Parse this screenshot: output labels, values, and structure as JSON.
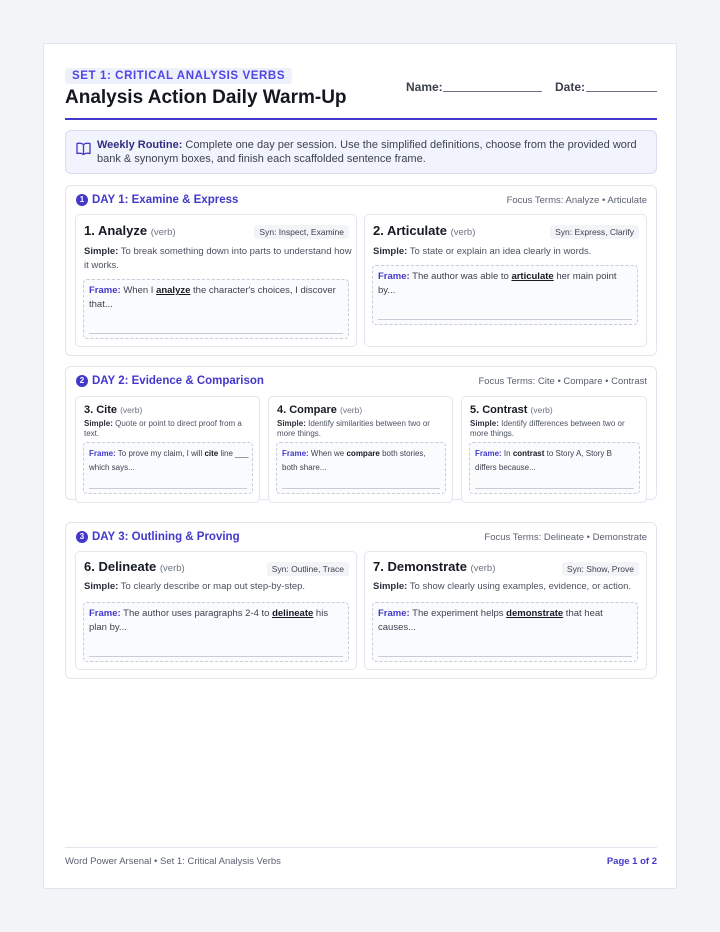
{
  "header": {
    "set_label": "SET 1: CRITICAL ANALYSIS VERBS",
    "title": "Analysis Action Daily Warm-Up",
    "name_label": "Name:",
    "date_label": "Date:"
  },
  "routine": {
    "icon": "book-icon",
    "label": "Weekly Routine:",
    "text": " Complete one day per session. Use the simplified definitions, choose from the provided word bank & synonym boxes, and finish each scaffolded sentence frame."
  },
  "days": [
    {
      "number": "1",
      "title": "DAY 1: Examine & Express",
      "focus": "Focus Terms: Analyze • Articulate",
      "words": [
        {
          "name": "1. Analyze",
          "pos": "(verb)",
          "syn": "Syn: Inspect, Examine",
          "simple_label": "Simple:",
          "simple": " To break something down into parts to understand how it works.",
          "frame_label": "Frame:",
          "frame_pre": " When I ",
          "frame_kw": "analyze",
          "frame_post": " the character's choices, I discover that..."
        },
        {
          "name": "2. Articulate",
          "pos": "(verb)",
          "syn": "Syn: Express, Clarify",
          "simple_label": "Simple:",
          "simple": " To state or explain an idea clearly in words.",
          "frame_label": "Frame:",
          "frame_pre": " The author was able to ",
          "frame_kw": "articulate",
          "frame_post": " her main point by..."
        }
      ]
    },
    {
      "number": "2",
      "title": "DAY 2: Evidence & Comparison",
      "focus": "Focus Terms: Cite • Compare • Contrast",
      "words": [
        {
          "name": "3. Cite",
          "pos": "(verb)",
          "simple_label": "Simple:",
          "simple": " Quote or point to direct proof from a text.",
          "frame_label": "Frame:",
          "frame_pre": " To prove my claim, I will ",
          "frame_kw": "cite",
          "frame_post": " line ___ which says..."
        },
        {
          "name": "4. Compare",
          "pos": "(verb)",
          "simple_label": "Simple:",
          "simple": " Identify similarities between two or more things.",
          "frame_label": "Frame:",
          "frame_pre": " When we ",
          "frame_kw": "compare",
          "frame_post": " both stories, both share..."
        },
        {
          "name": "5. Contrast",
          "pos": "(verb)",
          "simple_label": "Simple:",
          "simple": " Identify differences between two or more things.",
          "frame_label": "Frame:",
          "frame_pre": " In ",
          "frame_kw": "contrast",
          "frame_post": " to Story A, Story B differs because..."
        }
      ]
    },
    {
      "number": "3",
      "title": "DAY 3: Outlining & Proving",
      "focus": "Focus Terms: Delineate • Demonstrate",
      "words": [
        {
          "name": "6. Delineate",
          "pos": "(verb)",
          "syn": "Syn: Outline, Trace",
          "simple_label": "Simple:",
          "simple": " To clearly describe or map out step-by-step.",
          "frame_label": "Frame:",
          "frame_pre": " The author uses paragraphs 2-4 to ",
          "frame_kw": "delineate",
          "frame_post": " his plan by..."
        },
        {
          "name": "7. Demonstrate",
          "pos": "(verb)",
          "syn": "Syn: Show, Prove",
          "simple_label": "Simple:",
          "simple": " To show clearly using examples, evidence, or action.",
          "frame_label": "Frame:",
          "frame_pre": " The experiment helps ",
          "frame_kw": "demonstrate",
          "frame_post": " that heat causes..."
        }
      ]
    }
  ],
  "footer": {
    "left": "Word Power Arsenal • Set 1: Critical Analysis Verbs",
    "right": "Page 1 of 2"
  },
  "colors": {
    "accent": "#4338ca",
    "routine_bg": "#f1f3fd"
  }
}
